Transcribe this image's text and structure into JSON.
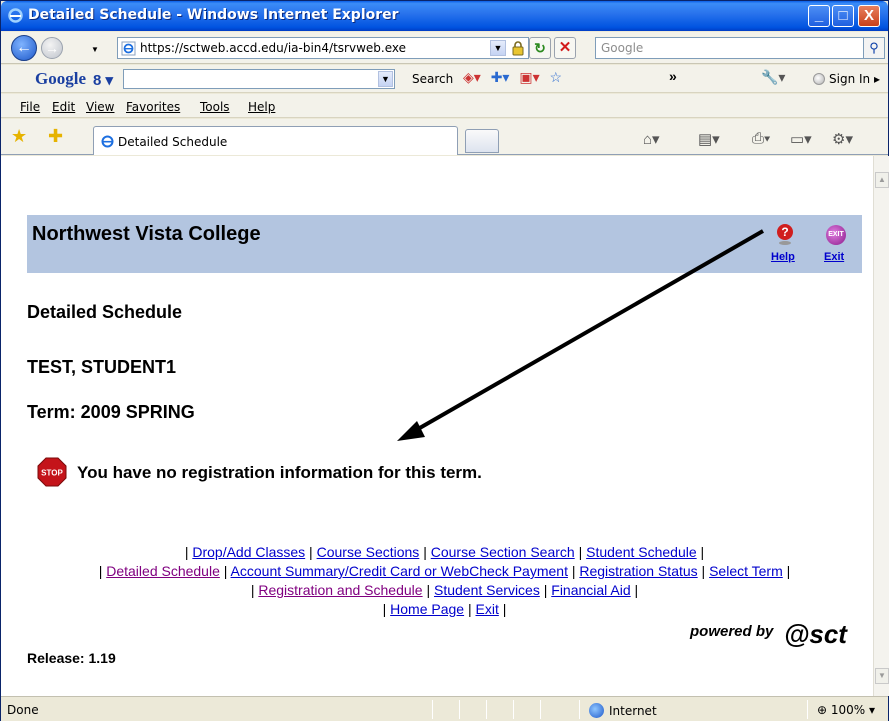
{
  "window": {
    "title": "Detailed Schedule - Windows Internet Explorer",
    "minimize_glyph": "_",
    "maximize_glyph": "□",
    "close_glyph": "X"
  },
  "address_bar": {
    "url": "https://sctweb.accd.edu/ia-bin4/tsrvweb.exe",
    "search_placeholder": "Google"
  },
  "google_toolbar": {
    "logo": "Google",
    "search_label": "Search",
    "more": "»",
    "sign_in": "Sign In"
  },
  "menu": {
    "file": "File",
    "edit": "Edit",
    "view": "View",
    "favorites": "Favorites",
    "tools": "Tools",
    "help": "Help"
  },
  "tab": {
    "label": "Detailed Schedule"
  },
  "page": {
    "college_name": "Northwest Vista College",
    "help_link": "Help",
    "exit_link": "Exit",
    "heading": "Detailed Schedule",
    "student": "TEST, STUDENT1",
    "term": "Term: 2009 SPRING",
    "message": "You have no registration information for this term.",
    "links": {
      "drop_add": "Drop/Add Classes",
      "course_sections": "Course Sections",
      "course_section_search": "Course Section Search",
      "student_schedule": "Student Schedule",
      "detailed_schedule": "Detailed Schedule",
      "account_summary": "Account Summary/Credit Card or WebCheck Payment",
      "registration_status": "Registration Status",
      "select_term": "Select Term",
      "registration_and_schedule": "Registration and Schedule",
      "student_services": "Student Services",
      "financial_aid": "Financial Aid",
      "home_page": "Home Page",
      "exit": "Exit"
    },
    "powered_by": "powered by",
    "brand": "sct",
    "release": "Release: 1.19",
    "stop_icon_text": "STOP",
    "exit_icon_text": "EXIT"
  },
  "status_bar": {
    "status": "Done",
    "zone": "Internet",
    "zoom": "100%"
  },
  "colors": {
    "title_bar": "#0053e0",
    "header_band": "#b3c5e0",
    "link": "#0000cc",
    "visited_link": "#800080"
  }
}
